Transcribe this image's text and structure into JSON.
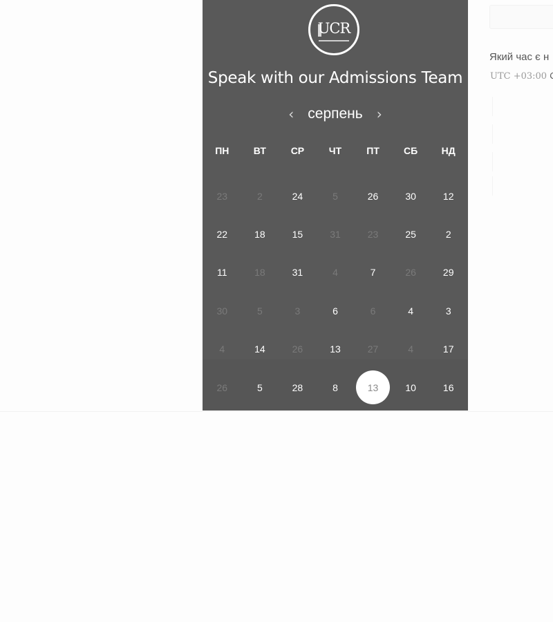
{
  "logo": {
    "text": "UCR"
  },
  "header": {
    "title": "Speak with our Admissions Team"
  },
  "calendar": {
    "month": "серпень",
    "prev_icon": "‹",
    "next_icon": "›",
    "weekdays": [
      "ПН",
      "ВТ",
      "СР",
      "ЧТ",
      "ПТ",
      "СБ",
      "НД"
    ],
    "rows": [
      [
        {
          "d": "23",
          "m": true
        },
        {
          "d": "2",
          "m": true
        },
        {
          "d": "24",
          "m": false
        },
        {
          "d": "5",
          "m": true
        },
        {
          "d": "26",
          "m": false
        },
        {
          "d": "30",
          "m": false
        },
        {
          "d": "12",
          "m": false
        }
      ],
      [
        {
          "d": "22",
          "m": false
        },
        {
          "d": "18",
          "m": false
        },
        {
          "d": "15",
          "m": false
        },
        {
          "d": "31",
          "m": true
        },
        {
          "d": "23",
          "m": true
        },
        {
          "d": "25",
          "m": false
        },
        {
          "d": "2",
          "m": false
        }
      ],
      [
        {
          "d": "11",
          "m": false
        },
        {
          "d": "18",
          "m": true
        },
        {
          "d": "31",
          "m": false
        },
        {
          "d": "4",
          "m": true
        },
        {
          "d": "7",
          "m": false
        },
        {
          "d": "26",
          "m": true
        },
        {
          "d": "29",
          "m": false
        }
      ],
      [
        {
          "d": "30",
          "m": true
        },
        {
          "d": "5",
          "m": true
        },
        {
          "d": "3",
          "m": true
        },
        {
          "d": "6",
          "m": false
        },
        {
          "d": "6",
          "m": true
        },
        {
          "d": "4",
          "m": false
        },
        {
          "d": "3",
          "m": false
        }
      ],
      [
        {
          "d": "4",
          "m": true
        },
        {
          "d": "14",
          "m": false
        },
        {
          "d": "26",
          "m": true
        },
        {
          "d": "13",
          "m": false
        },
        {
          "d": "27",
          "m": true
        },
        {
          "d": "4",
          "m": true
        },
        {
          "d": "17",
          "m": false
        }
      ],
      [
        {
          "d": "26",
          "m": true
        },
        {
          "d": "5",
          "m": false
        },
        {
          "d": "28",
          "m": false
        },
        {
          "d": "8",
          "m": false
        },
        {
          "d": "13",
          "m": false,
          "selected": true
        },
        {
          "d": "10",
          "m": false
        },
        {
          "d": "16",
          "m": false
        }
      ]
    ]
  },
  "side": {
    "question": "Який час є н",
    "tz_prefix": "UTC +03:00",
    "tz_city": "С"
  },
  "colors": {
    "panel": "#595959",
    "muted_day": "#7a7a7a",
    "selected_bg": "#ffffff"
  }
}
